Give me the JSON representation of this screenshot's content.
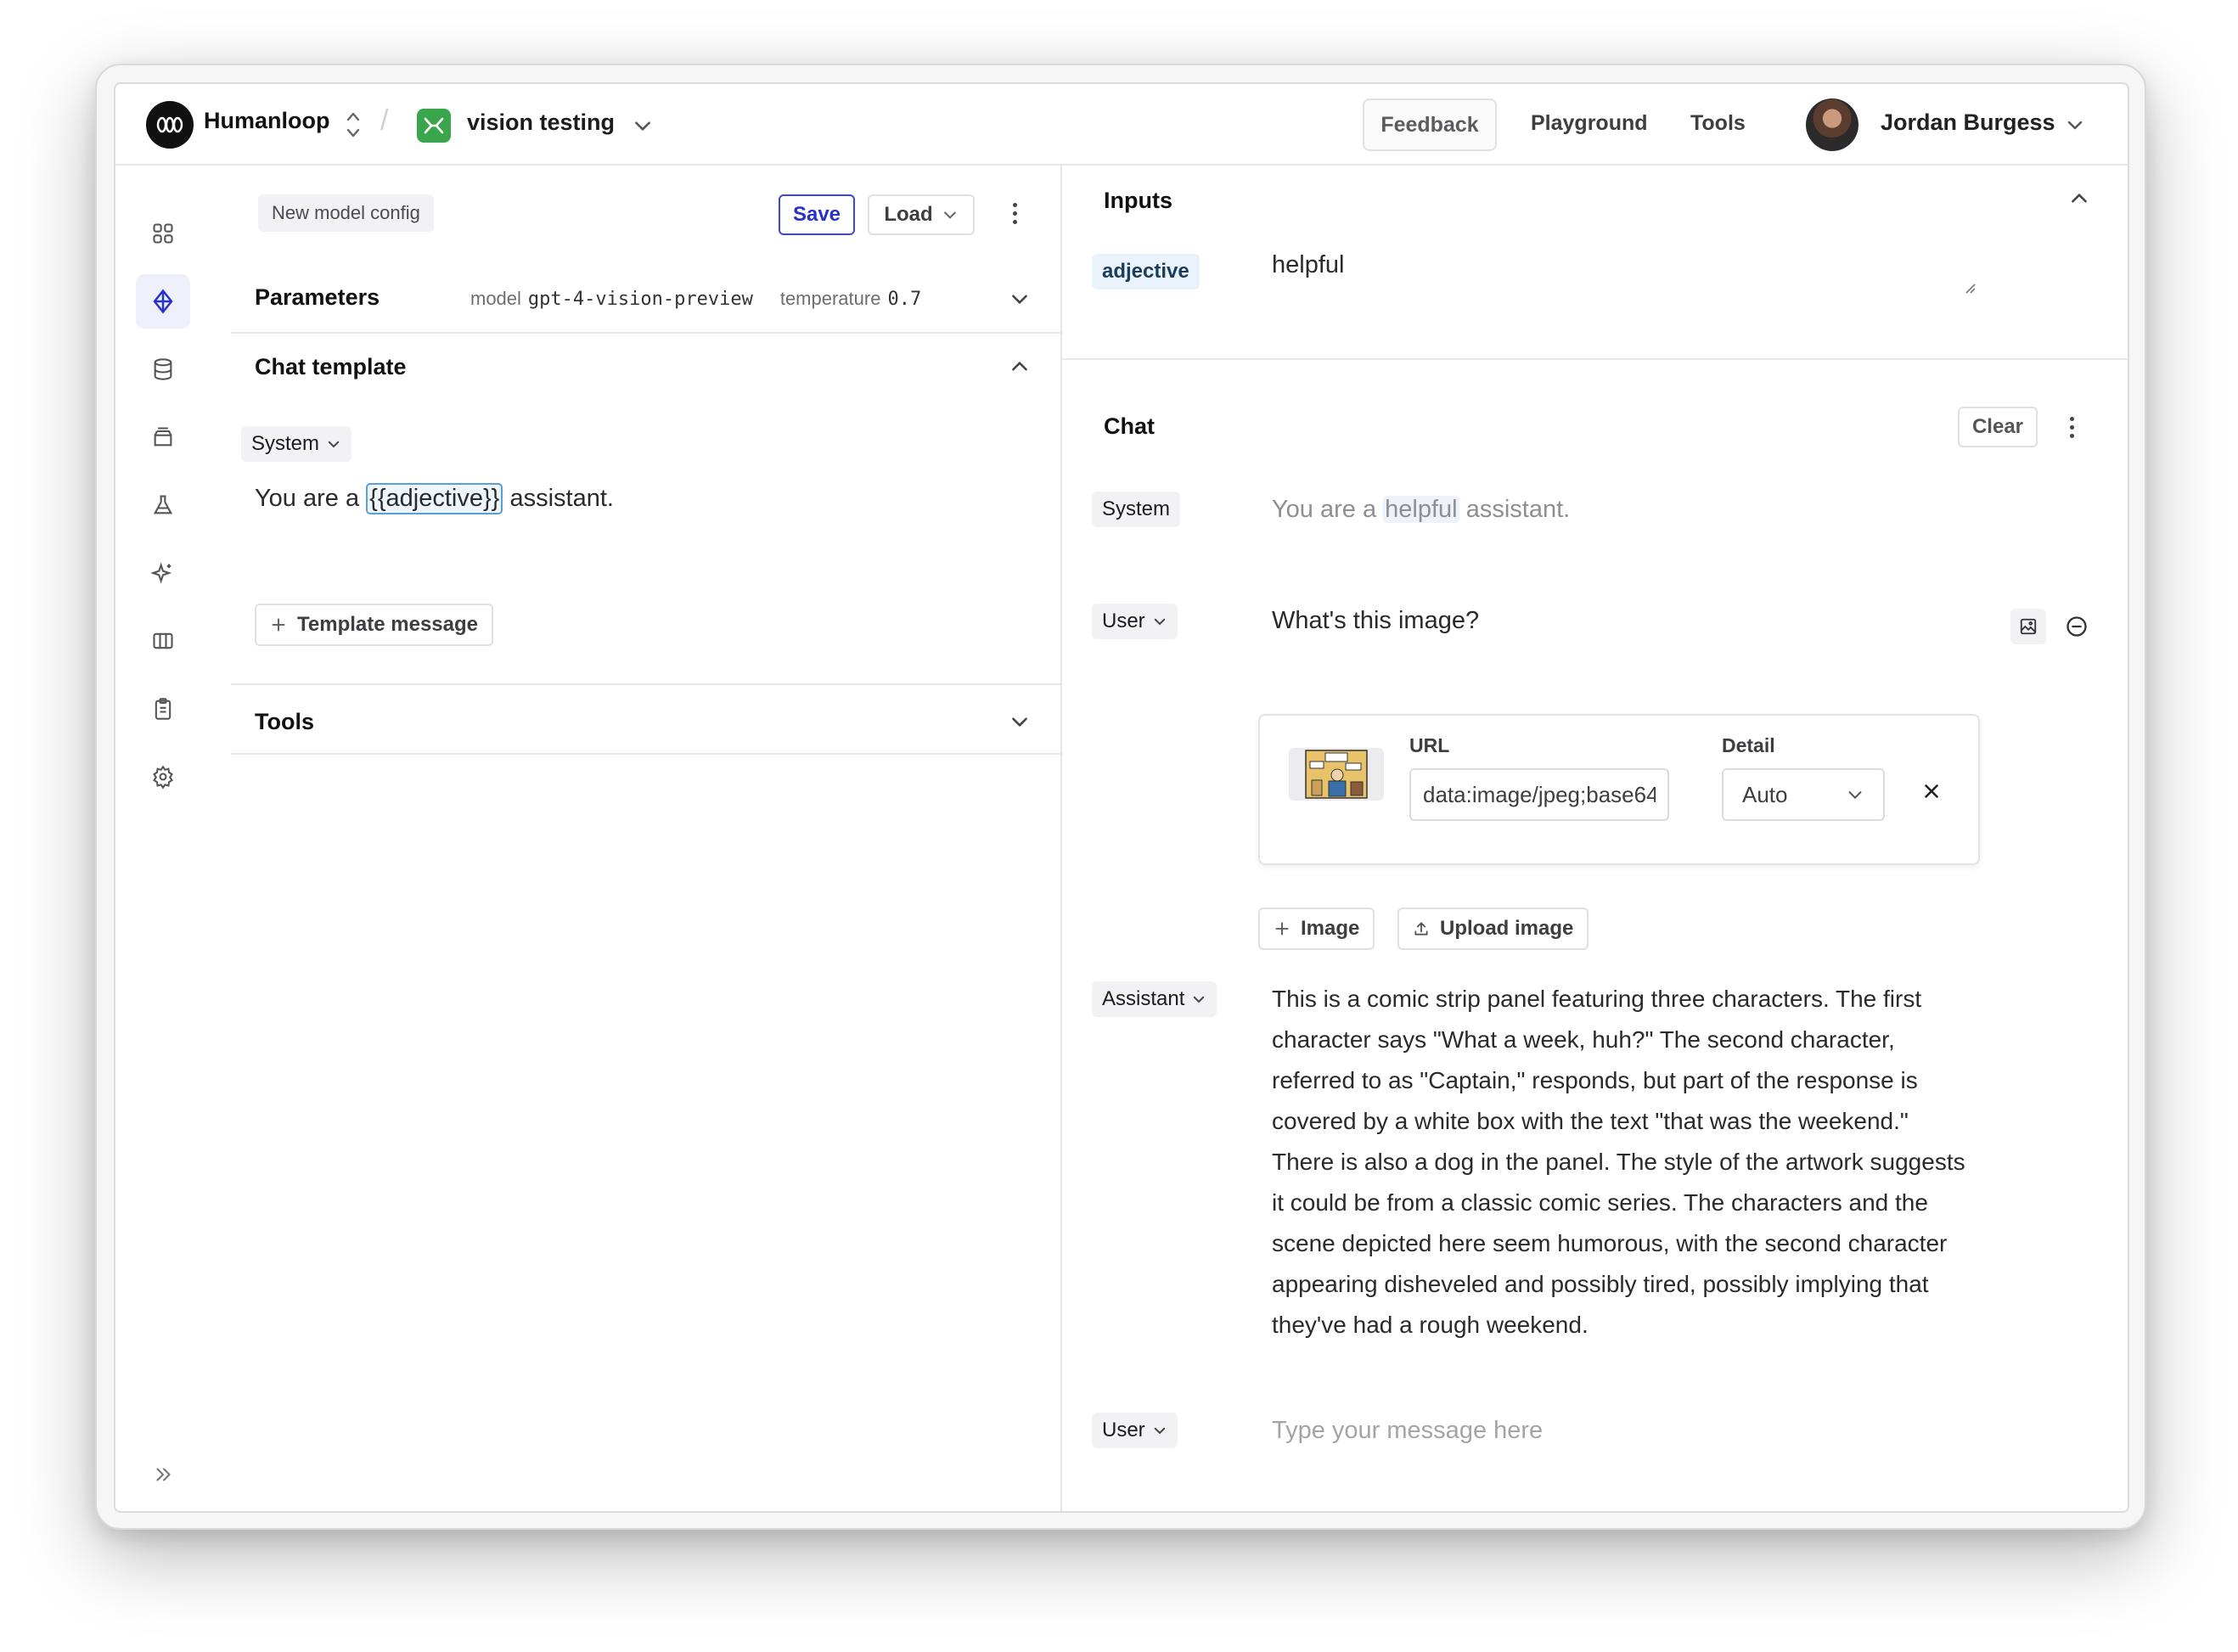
{
  "header": {
    "brand": "Humanloop",
    "project": "vision testing",
    "nav": {
      "feedback": "Feedback",
      "playground": "Playground",
      "tools": "Tools"
    },
    "user_name": "Jordan Burgess"
  },
  "sidebar": {
    "items": [
      {
        "icon": "grid-icon"
      },
      {
        "icon": "diamond-icon",
        "active": true
      },
      {
        "icon": "database-icon"
      },
      {
        "icon": "inbox-icon"
      },
      {
        "icon": "flask-icon"
      },
      {
        "icon": "sparkle-icon"
      },
      {
        "icon": "columns-icon"
      },
      {
        "icon": "clipboard-icon"
      },
      {
        "icon": "gear-icon"
      }
    ],
    "expand_icon": "double-chevron-right-icon"
  },
  "editor": {
    "config_name": "New model config",
    "save_label": "Save",
    "load_label": "Load",
    "parameters": {
      "title": "Parameters",
      "model_key": "model",
      "model_value": "gpt-4-vision-preview",
      "temperature_key": "temperature",
      "temperature_value": "0.7"
    },
    "chat_template": {
      "title": "Chat template",
      "role": "System",
      "text_before": "You are a",
      "variable": "{{adjective}}",
      "text_after": "assistant.",
      "add_label": "Template message"
    },
    "tools_title": "Tools"
  },
  "inputs": {
    "title": "Inputs",
    "name": "adjective",
    "value": "helpful"
  },
  "chat": {
    "title": "Chat",
    "clear_label": "Clear",
    "system": {
      "role": "System",
      "text_before": "You are a",
      "highlight": "helpful",
      "text_after": "assistant."
    },
    "user_message": {
      "role": "User",
      "text": "What's this image?",
      "image": {
        "url_label": "URL",
        "url_value": "data:image/jpeg;base64,",
        "detail_label": "Detail",
        "detail_value": "Auto"
      },
      "add_image_label": "Image",
      "upload_label": "Upload image"
    },
    "assistant": {
      "role": "Assistant",
      "text": "This is a comic strip panel featuring three characters. The first character says \"What a week, huh?\" The second character, referred to as \"Captain,\" responds, but part of the response is covered by a white box with the text \"that was the weekend.\" There is also a dog in the panel. The style of the artwork suggests it could be from a classic comic series. The characters and the scene depicted here seem humorous, with the second character appearing disheveled and possibly tired, possibly implying that they've had a rough weekend."
    },
    "composer": {
      "role": "User",
      "placeholder": "Type your message here"
    }
  },
  "colors": {
    "accent": "#2632c9",
    "project_icon": "#3aa64c",
    "variable_border": "#5aa0d6"
  }
}
